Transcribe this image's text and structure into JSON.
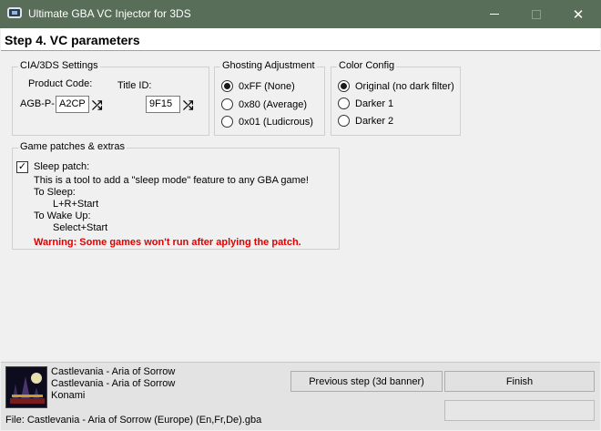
{
  "window": {
    "title": "Ultimate GBA VC Injector for 3DS"
  },
  "step": {
    "title": "Step 4. VC parameters"
  },
  "cia_settings": {
    "legend": "CIA/3DS Settings",
    "product_code_label": "Product Code:",
    "product_prefix": "AGB-P-",
    "product_code_value": "A2CP",
    "title_id_label": "Title ID:",
    "title_id_value": "9F15"
  },
  "ghosting": {
    "legend": "Ghosting Adjustment",
    "options": [
      "0xFF (None)",
      "0x80 (Average)",
      "0x01 (Ludicrous)"
    ],
    "selected_index": 0
  },
  "color_config": {
    "legend": "Color Config",
    "options": [
      "Original (no dark filter)",
      "Darker 1",
      "Darker 2"
    ],
    "selected_index": 0
  },
  "patches": {
    "legend": "Game patches & extras",
    "sleep_patch": {
      "checked": true,
      "label": "Sleep patch:",
      "desc": "This is a tool to add a \"sleep mode\" feature to any GBA game!",
      "to_sleep": "To Sleep:",
      "sleep_combo": "L+R+Start",
      "to_wake": "To Wake Up:",
      "wake_combo": "Select+Start",
      "warning": "Warning: Some games won't run after aplying the patch."
    }
  },
  "footer": {
    "game_title_1": "Castlevania - Aria of Sorrow",
    "game_title_2": "Castlevania - Aria of Sorrow",
    "publisher": "Konami",
    "file": "File: Castlevania - Aria of Sorrow (Europe) (En,Fr,De).gba",
    "prev_button": "Previous step (3d banner)",
    "finish_button": "Finish"
  }
}
